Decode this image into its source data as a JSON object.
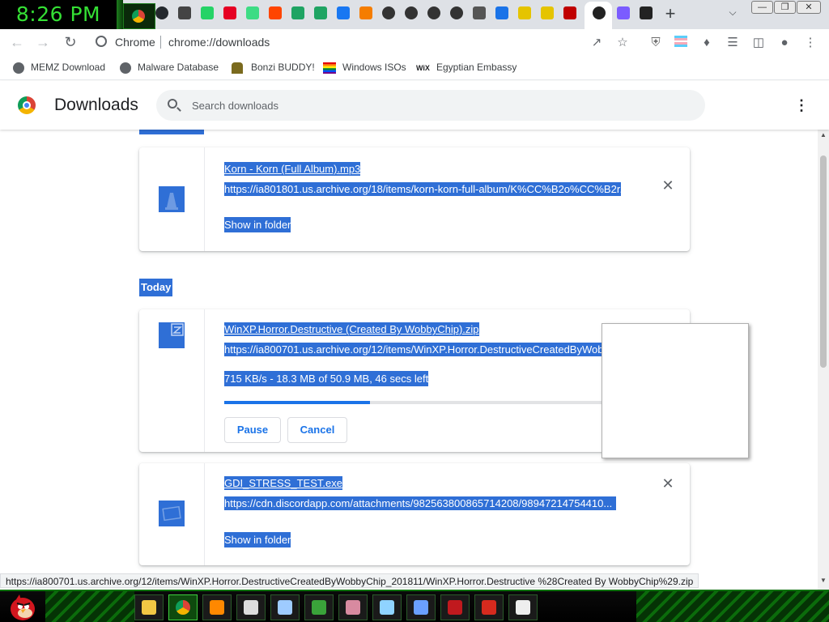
{
  "clock": {
    "time": "8:26 PM"
  },
  "tabstrip": {
    "tabs": [
      {
        "icon": "chrome-icon",
        "color": "#4285f4",
        "glyph": ""
      },
      {
        "icon": "github-icon",
        "color": "#24292e",
        "glyph": ""
      },
      {
        "icon": "mp3-icon",
        "color": "#444444",
        "glyph": ""
      },
      {
        "icon": "whatsapp-icon",
        "color": "#25d366",
        "glyph": ""
      },
      {
        "icon": "pinterest-icon",
        "color": "#e60023",
        "glyph": ""
      },
      {
        "icon": "android-icon",
        "color": "#3ddc84",
        "glyph": ""
      },
      {
        "icon": "reddit-icon",
        "color": "#ff4500",
        "glyph": ""
      },
      {
        "icon": "google-drive-icon",
        "color": "#1fa463",
        "glyph": ""
      },
      {
        "icon": "google-drive-icon",
        "color": "#1fa463",
        "glyph": ""
      },
      {
        "icon": "facebook-icon",
        "color": "#1877f2",
        "glyph": ""
      },
      {
        "icon": "blogger-icon",
        "color": "#f57d00",
        "glyph": ""
      },
      {
        "icon": "sound-icon",
        "color": "#333333",
        "glyph": ""
      },
      {
        "icon": "sound-icon",
        "color": "#333333",
        "glyph": ""
      },
      {
        "icon": "sound-icon",
        "color": "#333333",
        "glyph": ""
      },
      {
        "icon": "sound-icon",
        "color": "#333333",
        "glyph": ""
      },
      {
        "icon": "speaker-icon",
        "color": "#555555",
        "glyph": ""
      },
      {
        "icon": "download-icon",
        "color": "#1a73e8",
        "glyph": ""
      },
      {
        "icon": "bonzi-icon",
        "color": "#e5c400",
        "glyph": ""
      },
      {
        "icon": "bonzi-icon",
        "color": "#e5c400",
        "glyph": ""
      },
      {
        "icon": "lips-icon",
        "color": "#c00000",
        "glyph": ""
      },
      {
        "icon": "bird-icon",
        "color": "#222222",
        "glyph": ""
      },
      {
        "icon": "hexagon-icon",
        "color": "#7b5cff",
        "glyph": ""
      },
      {
        "icon": "archive-icon",
        "color": "#222222",
        "glyph": ""
      }
    ]
  },
  "toolbar": {
    "omnibox_label": "Chrome",
    "url": "chrome://downloads"
  },
  "bookmarks": [
    {
      "label": "MEMZ Download",
      "icon": "globe-icon"
    },
    {
      "label": "Malware Database",
      "icon": "globe-icon"
    },
    {
      "label": "Bonzi BUDDY!",
      "icon": "bonzi-icon"
    },
    {
      "label": "Windows ISOs",
      "icon": "windows-icon"
    },
    {
      "label": "Egyptian Embassy",
      "icon": "wix-icon"
    }
  ],
  "downloads_header": {
    "title": "Downloads",
    "search_placeholder": "Search downloads"
  },
  "groups": {
    "today_label": "Today"
  },
  "items": [
    {
      "filename": "Korn - Korn (Full Album).mp3",
      "url": "https://ia801801.us.archive.org/18/items/korn-korn-full-album/K%CC%B2o%CC%B2r...",
      "action": "Show in folder",
      "icon": "vlc-icon"
    },
    {
      "filename": "WinXP.Horror.Destructive (Created By WobbyChip).zip",
      "url": "https://ia800701.us.archive.org/12/items/WinXP.Horror.DestructiveCreatedByWobby...",
      "status": "715 KB/s - 18.3 MB of 50.9 MB, 46 secs left",
      "progress": 0.36,
      "pause_label": "Pause",
      "cancel_label": "Cancel",
      "icon": "zip-icon"
    },
    {
      "filename": "GDI_STRESS_TEST.exe",
      "url": "https://cdn.discordapp.com/attachments/982563800865714208/98947214754410...",
      "action": "Show in folder",
      "icon": "exe-icon"
    }
  ],
  "status_bar": {
    "url": "https://ia800701.us.archive.org/12/items/WinXP.Horror.DestructiveCreatedByWobbyChip_201811/WinXP.Horror.Destructive %28Created By WobbyChip%29.zip"
  },
  "taskbar": {
    "items": [
      {
        "icon": "folder-icon",
        "color": "#f2c744"
      },
      {
        "icon": "chrome-icon",
        "color": "#4285f4"
      },
      {
        "icon": "vlc-icon",
        "color": "#ff8800"
      },
      {
        "icon": "7zip-icon",
        "color": "#dddddd"
      },
      {
        "icon": "paint-icon",
        "color": "#9ecbff"
      },
      {
        "icon": "windows-media-icon",
        "color": "#3aa33a"
      },
      {
        "icon": "brain-icon",
        "color": "#d88aa0"
      },
      {
        "icon": "network-icon",
        "color": "#8fd3ff"
      },
      {
        "icon": "task-manager-icon",
        "color": "#6aa0ff"
      },
      {
        "icon": "flash-icon",
        "color": "#c0191e"
      },
      {
        "icon": "pdf-icon",
        "color": "#d62a1e"
      },
      {
        "icon": "terminal-icon",
        "color": "#eeeeee"
      }
    ]
  },
  "colors": {
    "selection": "#2f6fd6",
    "accent": "#1a73e8",
    "clock_text": "#35e035"
  }
}
